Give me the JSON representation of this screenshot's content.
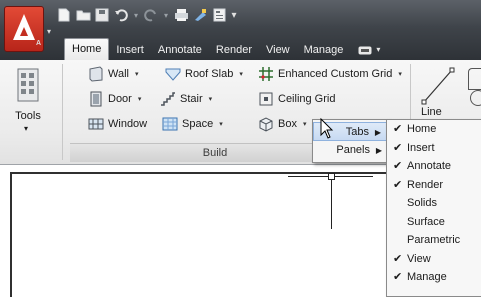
{
  "app_button": {
    "letter": "A",
    "icon": "autocad-logo-icon"
  },
  "quick_access": [
    {
      "name": "new-icon"
    },
    {
      "name": "open-icon"
    },
    {
      "name": "save-icon"
    },
    {
      "name": "undo-icon"
    },
    {
      "name": "redo-icon"
    },
    {
      "name": "plot-icon"
    },
    {
      "name": "match-properties-icon"
    },
    {
      "name": "properties-icon"
    },
    {
      "name": "customize-qat-icon"
    }
  ],
  "ribbon_tabs": {
    "home": "Home",
    "insert": "Insert",
    "annotate": "Annotate",
    "render": "Render",
    "view": "View",
    "manage": "Manage"
  },
  "ribbon": {
    "tools_label": "Tools",
    "panel_label": "Build",
    "buttons": {
      "wall": "Wall",
      "roof_slab": "Roof Slab",
      "enhanced_custom_grid": "Enhanced Custom Grid",
      "door": "Door",
      "stair": "Stair",
      "ceiling_grid": "Ceiling Grid",
      "window": "Window",
      "space": "Space",
      "box": "Box",
      "line": "Line"
    }
  },
  "context_menu": {
    "items": {
      "tabs": "Tabs",
      "panels": "Panels"
    }
  },
  "tabs_submenu": {
    "items": [
      {
        "label": "Home",
        "checked": true
      },
      {
        "label": "Insert",
        "checked": true
      },
      {
        "label": "Annotate",
        "checked": true
      },
      {
        "label": "Render",
        "checked": true
      },
      {
        "label": "Solids",
        "checked": false
      },
      {
        "label": "Surface",
        "checked": false
      },
      {
        "label": "Parametric",
        "checked": false
      },
      {
        "label": "View",
        "checked": true
      },
      {
        "label": "Manage",
        "checked": true
      }
    ]
  },
  "colors": {
    "accent_red": "#c32e20",
    "titlebar_dark": "#3f444a",
    "menu_highlight": "#c7daf2"
  }
}
